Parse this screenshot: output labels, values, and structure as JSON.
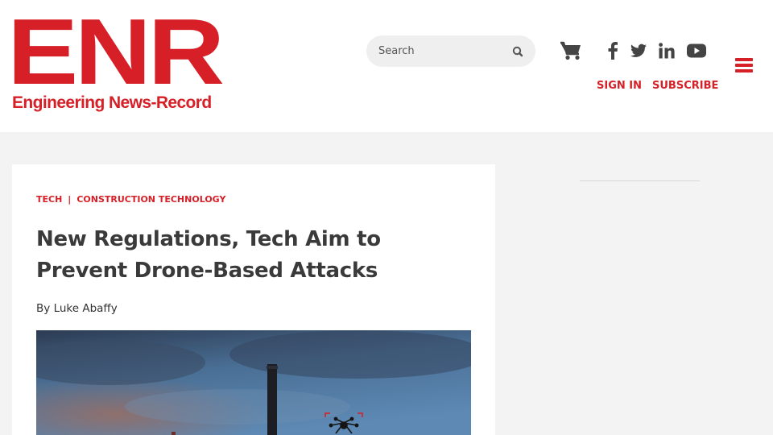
{
  "header": {
    "logo_main": "ENR",
    "logo_sub": "Engineering News-Record",
    "search": {
      "placeholder": "Search"
    },
    "cart_icon": "shopping-cart-icon",
    "social": [
      "facebook-icon",
      "twitter-icon",
      "linkedin-icon",
      "youtube-icon"
    ],
    "sign_in": "SIGN IN",
    "subscribe": "SUBSCRIBE",
    "menu_icon": "hamburger-menu-icon"
  },
  "article": {
    "categories": [
      "TECH",
      "CONSTRUCTION TECHNOLOGY"
    ],
    "separator": "|",
    "title": "New Regulations, Tech Aim to Prevent Drone-Based Attacks",
    "byline_prefix": "By",
    "author": "Luke Abaffy"
  },
  "colors": {
    "brand_red": "#d61f26",
    "page_bg": "#f3f3f3",
    "card_bg": "#ffffff",
    "text_dark": "#3a3a3a"
  }
}
